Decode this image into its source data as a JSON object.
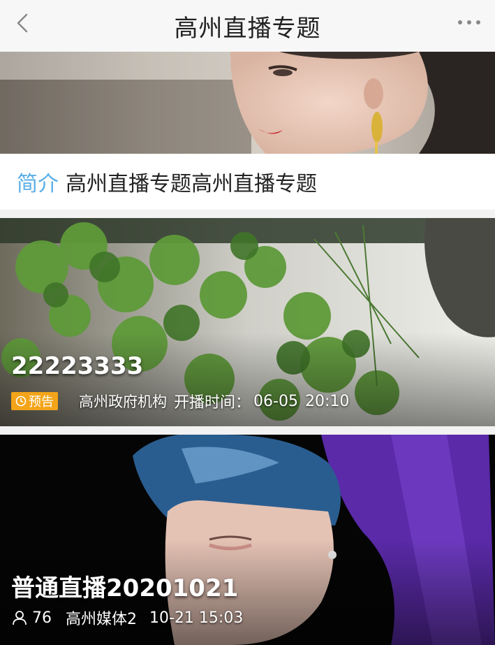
{
  "header": {
    "title": "高州直播专题",
    "back_icon": "chevron-left-icon",
    "more_icon": "more-dots-icon"
  },
  "intro": {
    "label": "简介",
    "text": "高州直播专题高州直播专题"
  },
  "cards": [
    {
      "title": "22223333",
      "badge": "预告",
      "badge_color": "#f3a419",
      "org": "高州政府机构",
      "time_label": "开播时间：",
      "date": "06-05",
      "time": "20:10"
    },
    {
      "title": "普通直播20201021",
      "viewer_count": "76",
      "media": "高州媒体2",
      "datetime": "10-21 15:03"
    }
  ],
  "colors": {
    "accent": "#5aaee6",
    "badge": "#f3a419"
  }
}
